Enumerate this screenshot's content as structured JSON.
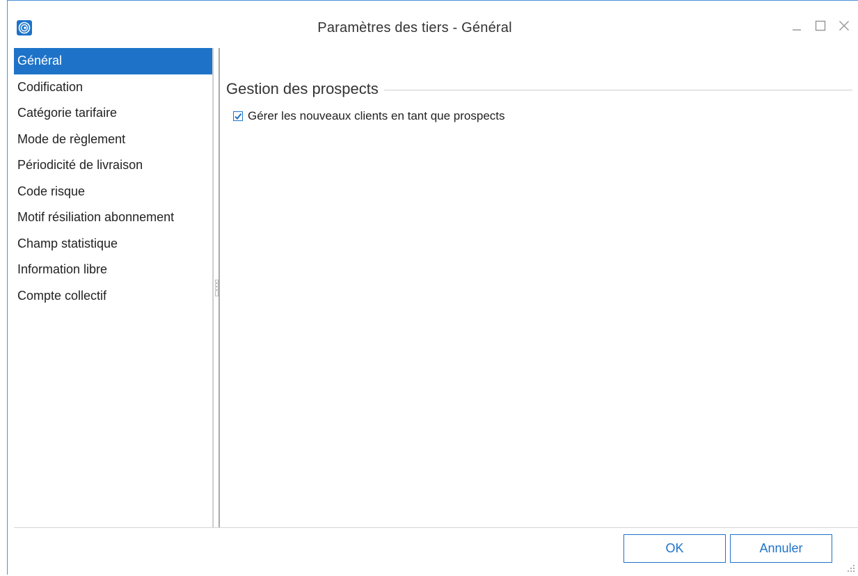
{
  "window": {
    "title": "Paramètres des tiers - Général",
    "controls": {
      "minimize": "minimize-icon",
      "maximize": "maximize-icon",
      "close": "close-icon"
    },
    "accent_color": "#1e73c8"
  },
  "nav": {
    "items": [
      {
        "label": "Général",
        "selected": true
      },
      {
        "label": "Codification",
        "selected": false
      },
      {
        "label": "Catégorie tarifaire",
        "selected": false
      },
      {
        "label": "Mode de règlement",
        "selected": false
      },
      {
        "label": "Périodicité de livraison",
        "selected": false
      },
      {
        "label": "Code risque",
        "selected": false
      },
      {
        "label": "Motif résiliation abonnement",
        "selected": false
      },
      {
        "label": "Champ statistique",
        "selected": false
      },
      {
        "label": "Information libre",
        "selected": false
      },
      {
        "label": "Compte collectif",
        "selected": false
      }
    ]
  },
  "main": {
    "section_title": "Gestion des prospects",
    "options": [
      {
        "label": "Gérer les nouveaux clients en tant que prospects",
        "checked": true
      }
    ]
  },
  "footer": {
    "ok_label": "OK",
    "cancel_label": "Annuler"
  }
}
